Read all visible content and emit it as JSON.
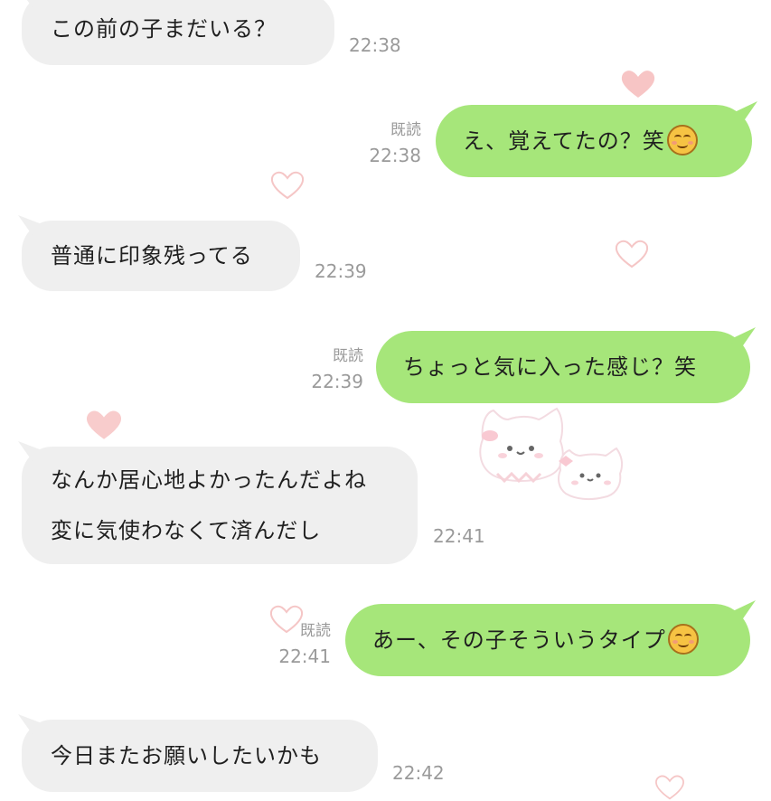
{
  "messages": [
    {
      "side": "in",
      "lines": [
        "この前の子まだいる？"
      ],
      "time": "22:38"
    },
    {
      "side": "out",
      "lines": [
        "え、覚えてたの？笑"
      ],
      "emoji": "relieved-face-emoji",
      "read": "既読",
      "time": "22:38"
    },
    {
      "side": "in",
      "lines": [
        "普通に印象残ってる"
      ],
      "time": "22:39"
    },
    {
      "side": "out",
      "lines": [
        "ちょっと気に入った感じ？笑"
      ],
      "read": "既読",
      "time": "22:39"
    },
    {
      "side": "in",
      "lines": [
        "なんか居心地よかったんだよね",
        "変に気使わなくて済んだし"
      ],
      "time": "22:41"
    },
    {
      "side": "out",
      "lines": [
        "あー、その子そういうタイプ"
      ],
      "emoji": "relieved-face-emoji",
      "read": "既読",
      "time": "22:41"
    },
    {
      "side": "in",
      "lines": [
        "今日またお願いしたいかも"
      ],
      "time": "22:42"
    }
  ],
  "colors": {
    "outgoing_bubble": "#a6e67a",
    "incoming_bubble": "#efefef",
    "meta_text": "#9a9a9a",
    "heart_pink": "#f5b8b8"
  },
  "background_decoration": [
    "heart-icon",
    "cat-sticker-icon"
  ]
}
